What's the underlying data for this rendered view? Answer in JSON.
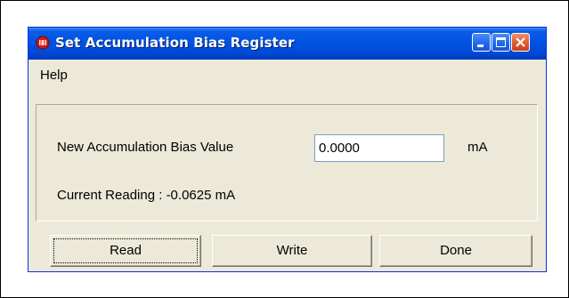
{
  "window": {
    "title": "Set Accumulation Bias Register",
    "icon": "red-chip-icon",
    "caption_buttons": [
      "minimize",
      "maximize",
      "close"
    ]
  },
  "menu": {
    "items": [
      "Help"
    ]
  },
  "form": {
    "field_label": "New Accumulation Bias Value",
    "field_value": "0.0000",
    "unit": "mA",
    "current_reading": "Current Reading : -0.0625 mA"
  },
  "buttons": {
    "read": "Read",
    "write": "Write",
    "done": "Done"
  },
  "colors": {
    "titlebar": "#0054e3",
    "close_button": "#e05a32",
    "window_background": "#ece9d8"
  }
}
